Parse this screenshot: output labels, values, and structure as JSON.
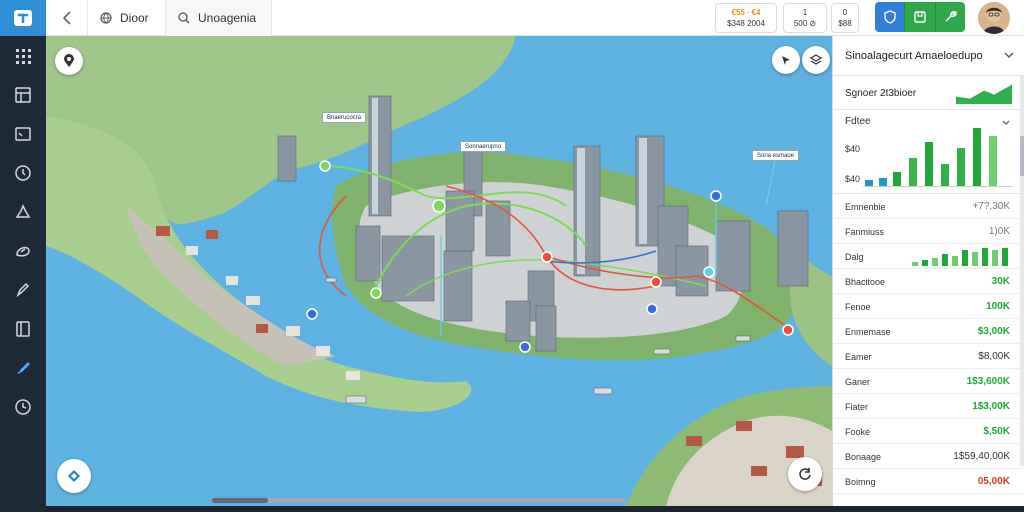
{
  "app": {
    "logo_icon": "app-logo-icon"
  },
  "rail": {
    "items": [
      {
        "name": "grid-icon"
      },
      {
        "name": "layers-icon"
      },
      {
        "name": "chart-icon"
      },
      {
        "name": "clock-icon"
      },
      {
        "name": "home-icon"
      },
      {
        "name": "compass-icon"
      },
      {
        "name": "edit-icon"
      },
      {
        "name": "panel-icon"
      },
      {
        "name": "paint-icon",
        "active": true
      },
      {
        "name": "history-icon"
      }
    ]
  },
  "topbar": {
    "tabs": [
      {
        "label": "Dioor",
        "icon": "globe-icon"
      },
      {
        "label": "Unoagenia",
        "icon": "search-icon"
      }
    ],
    "stats": [
      {
        "top": "€55  ∙  €4",
        "bottom": "$348  2004",
        "highlight": true
      },
      {
        "top": "1",
        "bottom": "500  ⊘"
      },
      {
        "top": "0",
        "bottom": "$88"
      }
    ],
    "actions": [
      "shield-icon",
      "save-icon",
      "tool-icon"
    ]
  },
  "map": {
    "tags": [
      "Bnaerucocra",
      "Sonnaerupno",
      "Sona esmaoe"
    ],
    "accent_colors": {
      "route_green": "#7ed957",
      "route_red": "#e5533d",
      "route_blue": "#3b6fd8",
      "water": "#5eb2e2",
      "land": "#9fc78a"
    }
  },
  "panel": {
    "title": "Sinoalagecurt Amaeloedupo",
    "summary_label": "Sgnoer 2t3bioer",
    "chart": {
      "title": "Fdtee",
      "y_labels": [
        "$40",
        "$40"
      ]
    },
    "rows": [
      {
        "label": "Emnenbie",
        "value": "+7?,30K",
        "style": "gray"
      },
      {
        "label": "Fanmiuss",
        "value": "1)0K",
        "style": "gray"
      },
      {
        "label": "Dalg",
        "value": "",
        "style": "bars"
      },
      {
        "label": "Bhacitooe",
        "value": "30K",
        "style": "green"
      },
      {
        "label": "Fenoe",
        "value": "100K",
        "style": "green"
      },
      {
        "label": "Enmemase",
        "value": "$3,00K",
        "style": "green"
      },
      {
        "label": "Eamer",
        "value": "$8,00K",
        "style": "dark"
      },
      {
        "label": "Ganer",
        "value": "1$3,600K",
        "style": "green"
      },
      {
        "label": "Fiater",
        "value": "1$3,00K",
        "style": "green"
      },
      {
        "label": "Fooke",
        "value": "$,50K",
        "style": "green"
      },
      {
        "label": "Bonaage",
        "value": "1$59,40,00K",
        "style": "dark"
      },
      {
        "label": "Boimng",
        "value": "05,00K",
        "style": "red"
      }
    ]
  }
}
